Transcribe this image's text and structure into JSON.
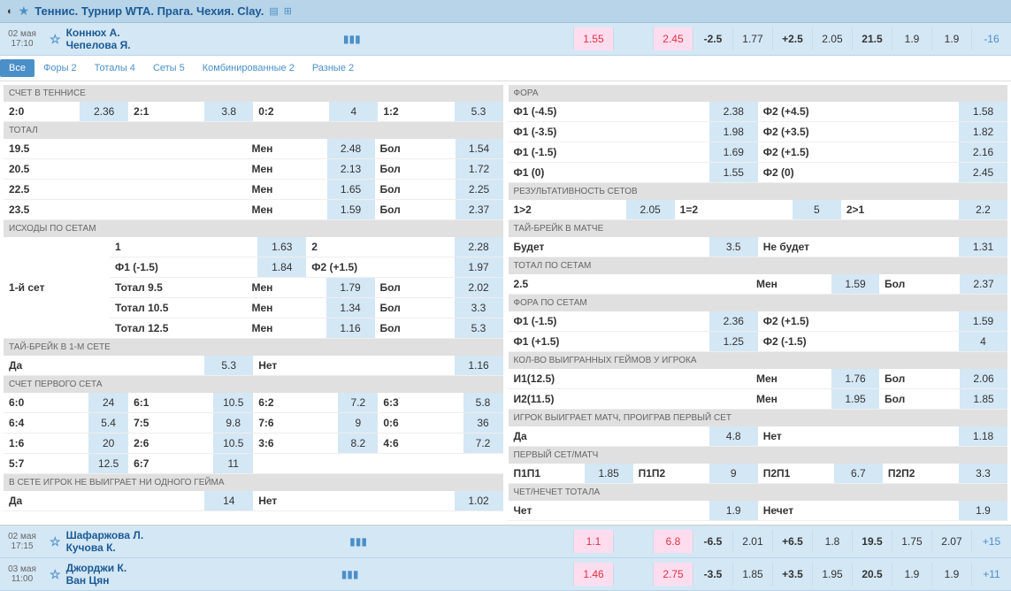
{
  "header": {
    "title": "Теннис. Турнир WTA. Прага. Чехия. Clay."
  },
  "match": {
    "date": "02 мая",
    "time": "17:10",
    "p1": "Коннюх А.",
    "p2": "Чепелова Я.",
    "odds": [
      {
        "v": "1.55",
        "cls": "red"
      },
      {
        "v": ""
      },
      {
        "v": "2.45",
        "cls": "red"
      },
      {
        "v": "-2.5",
        "cls": "bold"
      },
      {
        "v": "1.77"
      },
      {
        "v": "+2.5",
        "cls": "bold"
      },
      {
        "v": "2.05"
      },
      {
        "v": "21.5",
        "cls": "bold"
      },
      {
        "v": "1.9"
      },
      {
        "v": "1.9"
      },
      {
        "v": "-16",
        "cls": "last"
      }
    ]
  },
  "tabs": [
    {
      "l": "Все",
      "a": true
    },
    {
      "l": "Форы 2"
    },
    {
      "l": "Тоталы 4"
    },
    {
      "l": "Сеты 5"
    },
    {
      "l": "Комбинированные 2"
    },
    {
      "l": "Разные 2"
    }
  ],
  "left": {
    "tennis_score": {
      "h": "СЧЕТ В ТЕННИСЕ",
      "items": [
        {
          "l": "2:0",
          "v": "2.36"
        },
        {
          "l": "2:1",
          "v": "3.8"
        },
        {
          "l": "0:2",
          "v": "4"
        },
        {
          "l": "1:2",
          "v": "5.3"
        }
      ]
    },
    "total": {
      "h": "ТОТАЛ",
      "rows": [
        {
          "n": "19.5",
          "m": "2.48",
          "b": "1.54"
        },
        {
          "n": "20.5",
          "m": "2.13",
          "b": "1.72"
        },
        {
          "n": "22.5",
          "m": "1.65",
          "b": "2.25"
        },
        {
          "n": "23.5",
          "m": "1.59",
          "b": "2.37"
        }
      ],
      "men": "Мен",
      "bol": "Бол"
    },
    "sets": {
      "h": "ИСХОДЫ ПО СЕТАМ",
      "lead": "1-й сет",
      "rows": [
        {
          "c": [
            {
              "l": "1",
              "v": "1.63"
            },
            {
              "l": "2",
              "v": "2.28"
            }
          ]
        },
        {
          "c": [
            {
              "l": "Ф1 (-1.5)",
              "v": "1.84"
            },
            {
              "l": "Ф2 (+1.5)",
              "v": "1.97"
            }
          ]
        },
        {
          "c": [
            {
              "l": "Тотал 9.5",
              "m": "Мен",
              "v": "1.79"
            },
            {
              "l": "Бол",
              "v": "2.02"
            }
          ]
        },
        {
          "c": [
            {
              "l": "Тотал 10.5",
              "m": "Мен",
              "v": "1.34"
            },
            {
              "l": "Бол",
              "v": "3.3"
            }
          ]
        },
        {
          "c": [
            {
              "l": "Тотал 12.5",
              "m": "Мен",
              "v": "1.16"
            },
            {
              "l": "Бол",
              "v": "5.3"
            }
          ]
        }
      ]
    },
    "tiebreak1": {
      "h": "ТАЙ-БРЕЙК В 1-М СЕТЕ",
      "yes": "Да",
      "yv": "5.3",
      "no": "Нет",
      "nv": "1.16"
    },
    "first_set": {
      "h": "СЧЕТ ПЕРВОГО СЕТА",
      "rows": [
        [
          {
            "l": "6:0",
            "v": "24"
          },
          {
            "l": "6:1",
            "v": "10.5"
          },
          {
            "l": "6:2",
            "v": "7.2"
          },
          {
            "l": "6:3",
            "v": "5.8"
          }
        ],
        [
          {
            "l": "6:4",
            "v": "5.4"
          },
          {
            "l": "7:5",
            "v": "9.8"
          },
          {
            "l": "7:6",
            "v": "9"
          },
          {
            "l": "0:6",
            "v": "36"
          }
        ],
        [
          {
            "l": "1:6",
            "v": "20"
          },
          {
            "l": "2:6",
            "v": "10.5"
          },
          {
            "l": "3:6",
            "v": "8.2"
          },
          {
            "l": "4:6",
            "v": "7.2"
          }
        ],
        [
          {
            "l": "5:7",
            "v": "12.5"
          },
          {
            "l": "6:7",
            "v": "11"
          },
          {
            "l": "",
            "v": ""
          },
          {
            "l": "",
            "v": ""
          }
        ]
      ]
    },
    "nogame": {
      "h": "В СЕТЕ ИГРОК НЕ ВЫИГРАЕТ НИ ОДНОГО ГЕЙМА",
      "yes": "Да",
      "yv": "14",
      "no": "Нет",
      "nv": "1.02"
    }
  },
  "right": {
    "fora": {
      "h": "ФОРА",
      "rows": [
        {
          "l1": "Ф1 (-4.5)",
          "v1": "2.38",
          "l2": "Ф2 (+4.5)",
          "v2": "1.58"
        },
        {
          "l1": "Ф1 (-3.5)",
          "v1": "1.98",
          "l2": "Ф2 (+3.5)",
          "v2": "1.82"
        },
        {
          "l1": "Ф1 (-1.5)",
          "v1": "1.69",
          "l2": "Ф2 (+1.5)",
          "v2": "2.16"
        },
        {
          "l1": "Ф1 (0)",
          "v1": "1.55",
          "l2": "Ф2 (0)",
          "v2": "2.45"
        }
      ]
    },
    "result_sets": {
      "h": "РЕЗУЛЬТАТИВНОСТЬ СЕТОВ",
      "items": [
        {
          "l": "1>2",
          "v": "2.05"
        },
        {
          "l": "1=2",
          "v": "5"
        },
        {
          "l": "2>1",
          "v": "2.2"
        }
      ]
    },
    "tiebreak": {
      "h": "ТАЙ-БРЕЙК В МАТЧЕ",
      "yes": "Будет",
      "yv": "3.5",
      "no": "Не будет",
      "nv": "1.31"
    },
    "total_sets": {
      "h": "ТОТАЛ ПО СЕТАМ",
      "n": "2.5",
      "men": "Мен",
      "mv": "1.59",
      "bol": "Бол",
      "bv": "2.37"
    },
    "fora_sets": {
      "h": "ФОРА ПО СЕТАМ",
      "rows": [
        {
          "l1": "Ф1 (-1.5)",
          "v1": "2.36",
          "l2": "Ф2 (+1.5)",
          "v2": "1.59"
        },
        {
          "l1": "Ф1 (+1.5)",
          "v1": "1.25",
          "l2": "Ф2 (-1.5)",
          "v2": "4"
        }
      ]
    },
    "games_won": {
      "h": "КОЛ-ВО ВЫИГРАННЫХ ГЕЙМОВ У ИГРОКА",
      "rows": [
        {
          "l": "И1(12.5)",
          "men": "Мен",
          "mv": "1.76",
          "bol": "Бол",
          "bv": "2.06"
        },
        {
          "l": "И2(11.5)",
          "men": "Мен",
          "mv": "1.95",
          "bol": "Бол",
          "bv": "1.85"
        }
      ]
    },
    "lose_first": {
      "h": "ИГРОК ВЫИГРАЕТ МАТЧ, ПРОИГРАВ ПЕРВЫЙ СЕТ",
      "yes": "Да",
      "yv": "4.8",
      "no": "Нет",
      "nv": "1.18"
    },
    "first_match": {
      "h": "ПЕРВЫЙ СЕТ/МАТЧ",
      "items": [
        {
          "l": "П1П1",
          "v": "1.85"
        },
        {
          "l": "П1П2",
          "v": "9"
        },
        {
          "l": "П2П1",
          "v": "6.7"
        },
        {
          "l": "П2П2",
          "v": "3.3"
        }
      ]
    },
    "odd_even": {
      "h": "ЧЕТ/НЕЧЕТ ТОТАЛА",
      "l1": "Чет",
      "v1": "1.9",
      "l2": "Нечет",
      "v2": "1.9"
    }
  },
  "bottom": [
    {
      "date": "02 мая",
      "time": "17:15",
      "p1": "Шафаржова Л.",
      "p2": "Кучова К.",
      "odds": [
        {
          "v": "1.1",
          "cls": "red"
        },
        {
          "v": ""
        },
        {
          "v": "6.8",
          "cls": "red"
        },
        {
          "v": "-6.5",
          "cls": "bold"
        },
        {
          "v": "2.01"
        },
        {
          "v": "+6.5",
          "cls": "bold"
        },
        {
          "v": "1.8"
        },
        {
          "v": "19.5",
          "cls": "bold"
        },
        {
          "v": "1.75"
        },
        {
          "v": "2.07"
        },
        {
          "v": "+15",
          "cls": "last"
        }
      ]
    },
    {
      "date": "03 мая",
      "time": "11:00",
      "p1": "Джорджи К.",
      "p2": "Ван Цян",
      "odds": [
        {
          "v": "1.46",
          "cls": "red"
        },
        {
          "v": ""
        },
        {
          "v": "2.75",
          "cls": "red"
        },
        {
          "v": "-3.5",
          "cls": "bold"
        },
        {
          "v": "1.85"
        },
        {
          "v": "+3.5",
          "cls": "bold"
        },
        {
          "v": "1.95"
        },
        {
          "v": "20.5",
          "cls": "bold"
        },
        {
          "v": "1.9"
        },
        {
          "v": "1.9"
        },
        {
          "v": "+11",
          "cls": "last"
        }
      ]
    }
  ]
}
